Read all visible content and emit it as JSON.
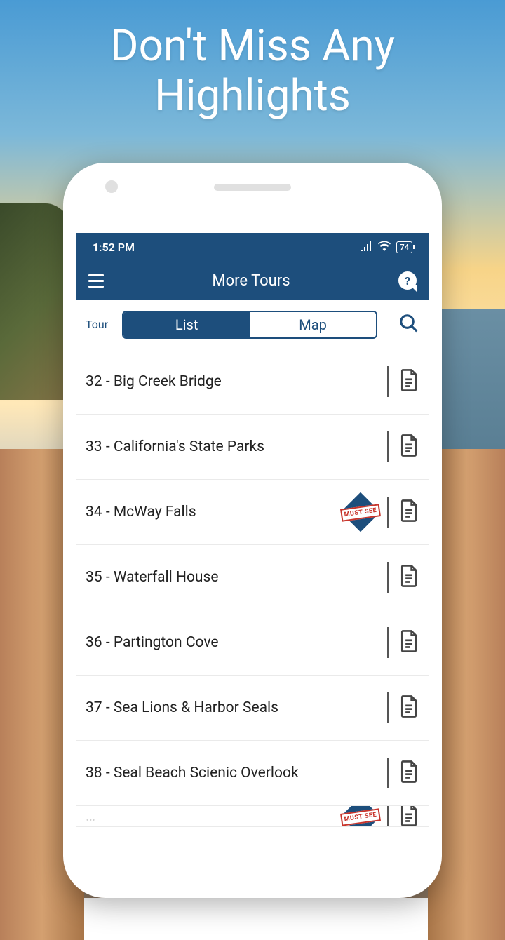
{
  "promo": {
    "title": "Don't Miss Any\nHighlights"
  },
  "status": {
    "time": "1:52 PM",
    "battery": "74"
  },
  "appbar": {
    "title": "More Tours"
  },
  "filter": {
    "tour_label": "Tour",
    "list_label": "List",
    "map_label": "Map"
  },
  "must_see_label": "MUST SEE",
  "items": [
    {
      "num": "32",
      "name": "Big Creek Bridge",
      "must_see": false
    },
    {
      "num": "33",
      "name": "California's State Parks",
      "must_see": false
    },
    {
      "num": "34",
      "name": "McWay Falls",
      "must_see": true
    },
    {
      "num": "35",
      "name": "Waterfall House",
      "must_see": false
    },
    {
      "num": "36",
      "name": "Partington Cove",
      "must_see": false
    },
    {
      "num": "37",
      "name": "Sea Lions & Harbor Seals",
      "must_see": false
    },
    {
      "num": "38",
      "name": "Seal Beach Scienic Overlook",
      "must_see": false
    }
  ]
}
